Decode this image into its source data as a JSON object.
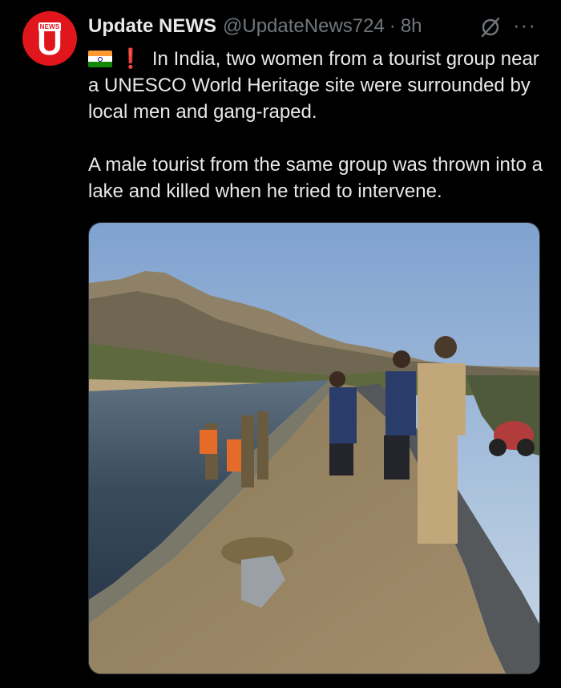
{
  "author": {
    "display_name": "Update NEWS",
    "handle": "@UpdateNews724",
    "separator": "·",
    "time": "8h",
    "avatar_badge": "NEWS",
    "avatar_letter": "U"
  },
  "post": {
    "flag_icon": "india-flag-icon",
    "alert_icon": "red-exclamation-icon",
    "alert_glyph": "❗",
    "paragraph_1": "In India, two women from a tourist group near a UNESCO World Heritage site were surrounded by local men and gang-raped.",
    "paragraph_2": "A male tourist from the same group was thrown into a lake and killed when he tried to intervene."
  },
  "actions": {
    "grok_icon": "grok-icon",
    "more_label": "···"
  },
  "media": {
    "icon": "photo-canal-police-search"
  },
  "colors": {
    "background": "#000000",
    "text": "#e7e9ea",
    "muted": "#71767b",
    "brand_red": "#e0161c"
  }
}
